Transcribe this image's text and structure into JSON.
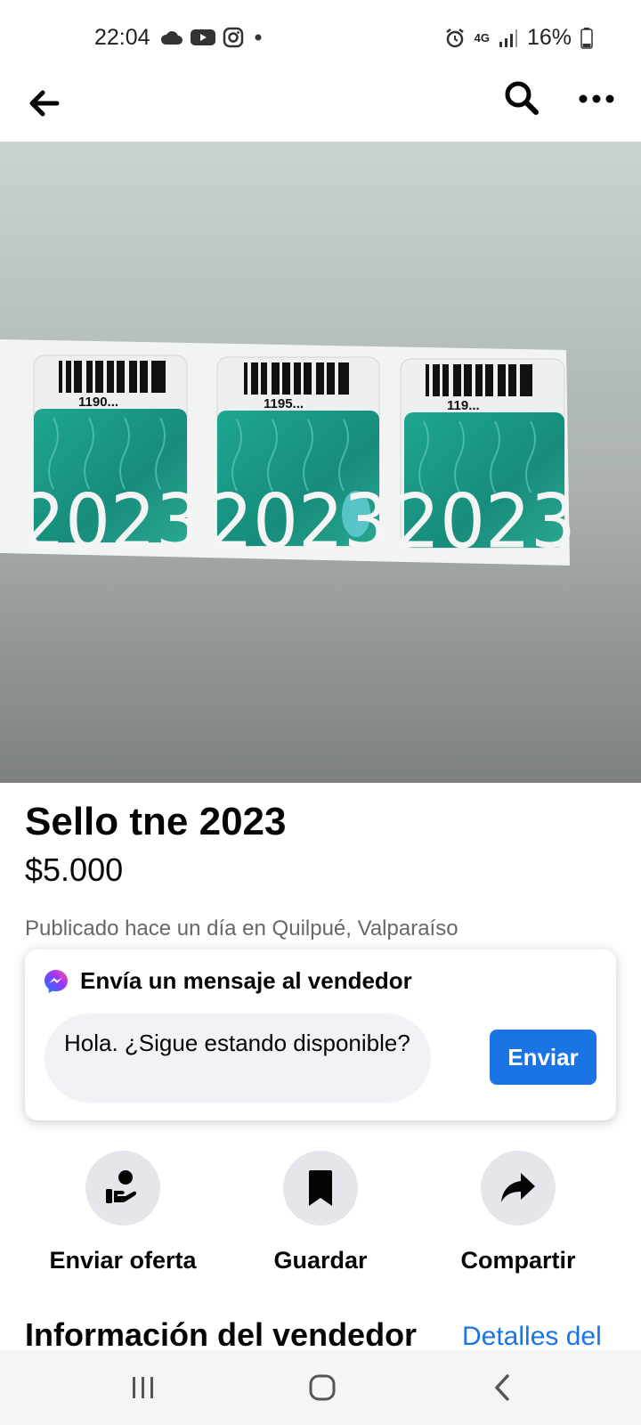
{
  "status": {
    "time": "22:04",
    "network": "4G",
    "battery": "16%"
  },
  "listing": {
    "image_text": "2023",
    "barcodes": [
      "1190...",
      "1195...",
      "119..."
    ],
    "title": "Sello tne 2023",
    "price": "$5.000",
    "posted": "Publicado hace un día en Quilpué, Valparaíso"
  },
  "message": {
    "heading": "Envía un mensaje al vendedor",
    "input_value": "Hola. ¿Sigue estando disponible?",
    "send_label": "Enviar"
  },
  "actions": [
    {
      "label": "Enviar oferta",
      "icon": "offer-icon"
    },
    {
      "label": "Guardar",
      "icon": "bookmark-icon"
    },
    {
      "label": "Compartir",
      "icon": "share-icon"
    }
  ],
  "seller": {
    "title": "Información del vendedor",
    "details_link": "Detalles del"
  },
  "colors": {
    "accent": "#1b74e4",
    "sticker_teal": "#1d9a8c"
  }
}
